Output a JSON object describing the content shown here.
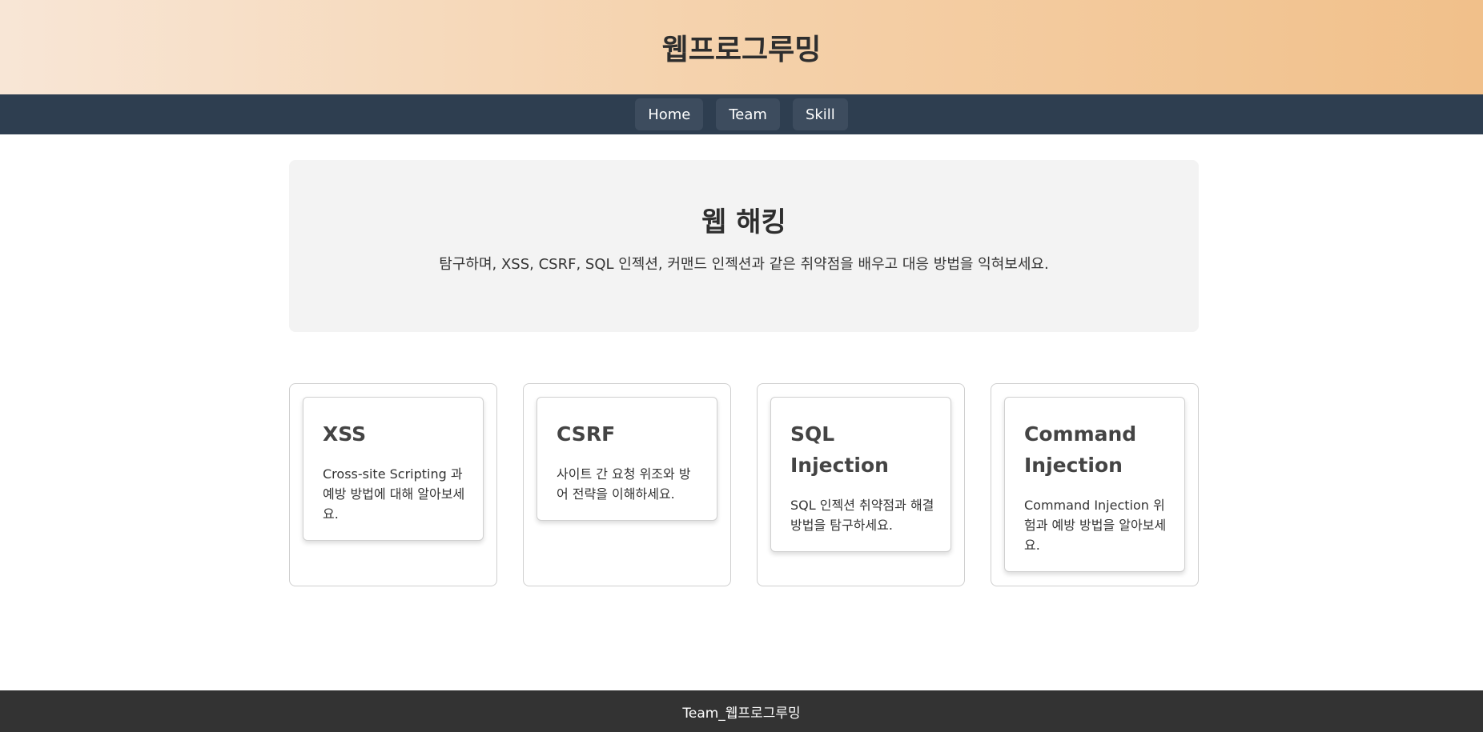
{
  "header": {
    "title": "웹프로그루밍"
  },
  "nav": {
    "items": [
      {
        "label": "Home"
      },
      {
        "label": "Team"
      },
      {
        "label": "Skill"
      }
    ]
  },
  "hero": {
    "title": "웹 해킹",
    "description": "탐구하며, XSS, CSRF, SQL 인젝션, 커맨드 인젝션과 같은 취약점을 배우고 대응 방법을 익혀보세요."
  },
  "cards": [
    {
      "title": "XSS",
      "description": "Cross-site Scripting 과 예방 방법에 대해 알아보세요."
    },
    {
      "title": "CSRF",
      "description": "사이트 간 요청 위조와 방어 전략을 이해하세요."
    },
    {
      "title": "SQL Injection",
      "description": "SQL 인젝션 취약점과 해결 방법을 탐구하세요."
    },
    {
      "title": "Command Injection",
      "description": "Command Injection 위험과 예방 방법을 알아보세요."
    }
  ],
  "footer": {
    "text": "Team_웹프로그루밍"
  },
  "colors": {
    "nav_background": "#2e3e50",
    "footer_background": "#333333",
    "header_gradient_start": "#f8e6d6",
    "header_gradient_end": "#f1c08a"
  }
}
